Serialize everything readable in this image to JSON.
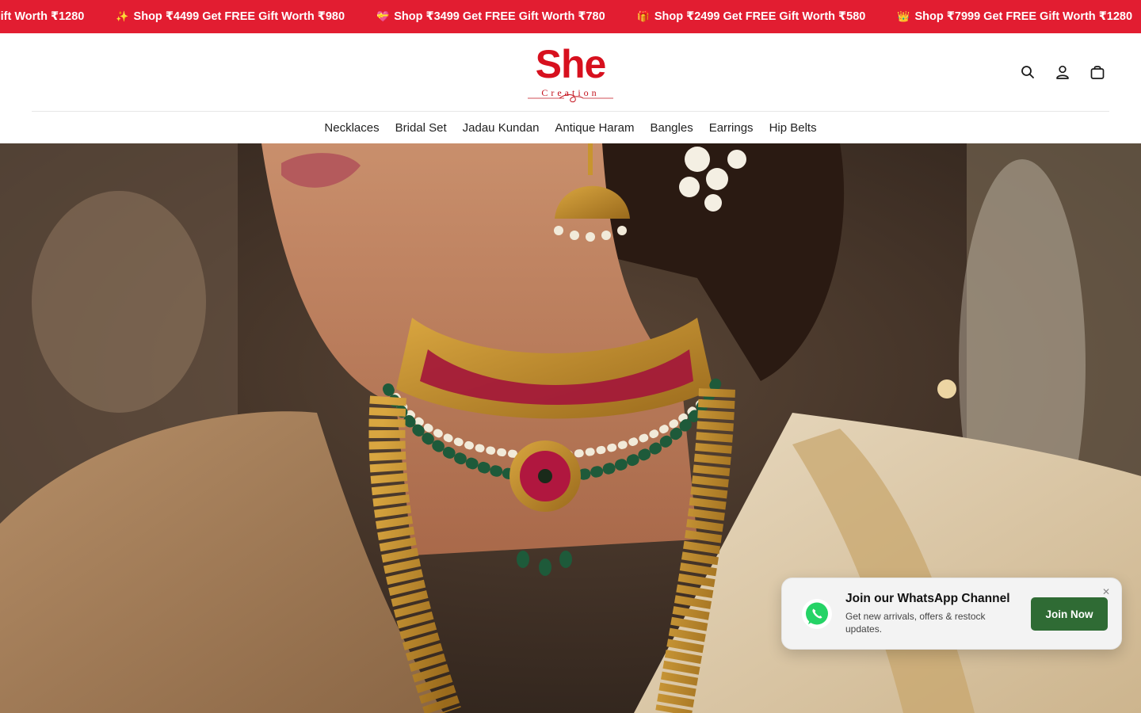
{
  "announcement": {
    "items": [
      {
        "emoji": "",
        "text": "EE Gift Worth ₹1280"
      },
      {
        "emoji": "✨",
        "text": "Shop ₹4499 Get FREE Gift Worth ₹980"
      },
      {
        "emoji": "💝",
        "text": "Shop ₹3499 Get FREE Gift Worth ₹780"
      },
      {
        "emoji": "🎁",
        "text": "Shop ₹2499 Get FREE Gift Worth ₹580"
      },
      {
        "emoji": "👑",
        "text": "Shop ₹7999 Get FREE Gift Worth ₹1280"
      },
      {
        "emoji": "✨",
        "text": ""
      }
    ],
    "background": "#e21d31"
  },
  "header": {
    "logo": {
      "main": "She",
      "sub": "Creation",
      "color": "#d7101e"
    },
    "icons": [
      "search-icon",
      "account-icon",
      "cart-icon"
    ]
  },
  "nav": {
    "items": [
      "Necklaces",
      "Bridal Set",
      "Jadau Kundan",
      "Antique Haram",
      "Bangles",
      "Earrings",
      "Hip Belts"
    ]
  },
  "whatsapp_popup": {
    "title": "Join our WhatsApp Channel",
    "description": "Get new arrivals, offers & restock updates.",
    "button_label": "Join Now",
    "close_label": "✕",
    "button_color": "#2f6b34"
  }
}
